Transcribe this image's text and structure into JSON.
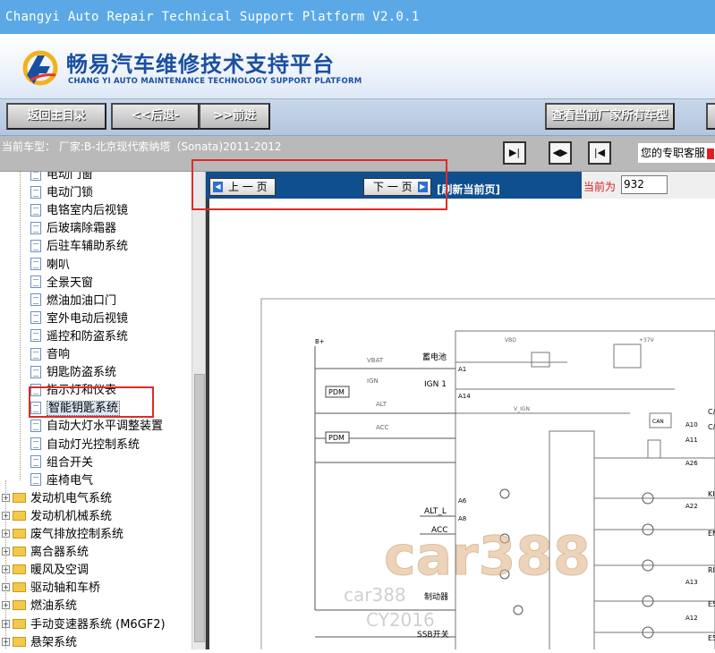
{
  "window": {
    "title": "Changyi Auto Repair Technical Support Platform V2.0.1"
  },
  "brand": {
    "cn_name": "畅易汽车维修技术支持平台",
    "en_name": "CHANG YI AUTO MAINTENANCE TECHNOLOGY SUPPORT PLATFORM",
    "accent": "#1a4fa0"
  },
  "toolbar": {
    "home_label": "返回主目录",
    "back_label": "<<后退-",
    "forward_label": ">>前进",
    "all_models_label": "查看当前厂家所有车型"
  },
  "infobar": {
    "current_car": "当前车型： 厂家:B-北京现代索纳塔（Sonata)2011-2012",
    "support_text": "您的专职客服"
  },
  "sidebar": {
    "items": [
      {
        "label": "电动门窗",
        "type": "doc"
      },
      {
        "label": "电动门锁",
        "type": "doc"
      },
      {
        "label": "电铬室内后视镜",
        "type": "doc"
      },
      {
        "label": "后玻璃除霜器",
        "type": "doc"
      },
      {
        "label": "后驻车辅助系统",
        "type": "doc"
      },
      {
        "label": "喇叭",
        "type": "doc"
      },
      {
        "label": "全景天窗",
        "type": "doc"
      },
      {
        "label": "燃油加油口门",
        "type": "doc"
      },
      {
        "label": "室外电动后视镜",
        "type": "doc"
      },
      {
        "label": "遥控和防盗系统",
        "type": "doc"
      },
      {
        "label": "音响",
        "type": "doc"
      },
      {
        "label": "钥匙防盗系统",
        "type": "doc"
      },
      {
        "label": "指示灯和仪表",
        "type": "doc"
      },
      {
        "label": "智能钥匙系统",
        "type": "doc",
        "selected": true
      },
      {
        "label": "自动大灯水平调整装置",
        "type": "doc"
      },
      {
        "label": "自动灯光控制系统",
        "type": "doc"
      },
      {
        "label": "组合开关",
        "type": "doc"
      },
      {
        "label": "座椅电气",
        "type": "doc"
      },
      {
        "label": "发动机电气系统",
        "type": "folder"
      },
      {
        "label": "发动机机械系统",
        "type": "folder"
      },
      {
        "label": "废气排放控制系统",
        "type": "folder"
      },
      {
        "label": "离合器系统",
        "type": "folder"
      },
      {
        "label": "暖风及空调",
        "type": "folder"
      },
      {
        "label": "驱动轴和车桥",
        "type": "folder"
      },
      {
        "label": "燃油系统",
        "type": "folder"
      },
      {
        "label": "手动变速器系统 (M6GF2)",
        "type": "folder"
      },
      {
        "label": "悬架系统",
        "type": "folder"
      }
    ]
  },
  "pager": {
    "prev_label": "上 一 页",
    "next_label": "下 一 页",
    "refresh_label": "[刷新当前页]",
    "current_label": "当前为",
    "current_value": "932"
  },
  "diagram": {
    "labels": {
      "bplus": "B+",
      "vbat": "VBAT",
      "battery": "蓄电池",
      "ign1": "IGN 1",
      "pdm1": "PDM",
      "pdm2": "PDM",
      "ign": "IGN",
      "alt": "ALT",
      "acc_small": "ACC",
      "alt_l": "ALT_L",
      "acc": "ACC",
      "vbd": "VBD",
      "vign": "V_IGN",
      "can": "CAN",
      "a1": "A1",
      "a14": "A14",
      "a6": "A6",
      "a8": "A8",
      "a10": "A10",
      "a11": "A11",
      "a26": "A26",
      "a22": "A22",
      "a13": "A13",
      "a12": "A12",
      "brake": "制动器",
      "ssb": "SSB开关",
      "r1": "C/",
      "r2": "C/",
      "r3": "KI",
      "r4": "EN",
      "r5": "RI",
      "r6": "E5",
      "r7": "E5",
      "v37": "+37V"
    },
    "watermark": {
      "brand": "car388",
      "site": "car388",
      "code": "CY2016"
    }
  },
  "colors": {
    "titlebar": "#5aa9e6",
    "pager_bg": "#0f4f8e",
    "highlight": "#e02a2a"
  }
}
